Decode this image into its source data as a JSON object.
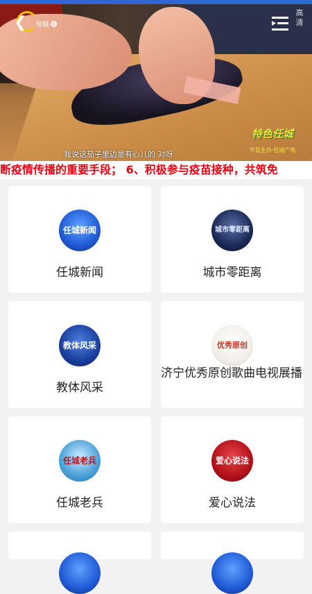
{
  "video": {
    "channel_label": "任城-🅑",
    "hd_label": "高清",
    "subtitle": "我说这茄子里边是有心儿的  对呀",
    "badge_title": "特色任城",
    "badge_sub": "节目主办·任城广电"
  },
  "ticker": {
    "text": "断疫情传播的重要手段；  6、积极参与疫苗接种，共筑免"
  },
  "grid": {
    "items": [
      {
        "label": "任城新闻",
        "thumb_text": "任城新闻",
        "color": "#1f5bd6"
      },
      {
        "label": "城市零距离",
        "thumb_text": "城市零距离",
        "color": "#1b2a55"
      },
      {
        "label": "教体风采",
        "thumb_text": "教体风采",
        "color": "#1a3f9e"
      },
      {
        "label": "济宁优秀原创歌曲电视展播",
        "thumb_text": "优秀原创",
        "color": "#f2efe9"
      },
      {
        "label": "任城老兵",
        "thumb_text": "任城老兵",
        "color": "#4aa1d8"
      },
      {
        "label": "爱心说法",
        "thumb_text": "爱心说法",
        "color": "#b3121a"
      }
    ]
  },
  "colors": {
    "accent": "#2f68d6",
    "ticker_text": "#e60012"
  }
}
